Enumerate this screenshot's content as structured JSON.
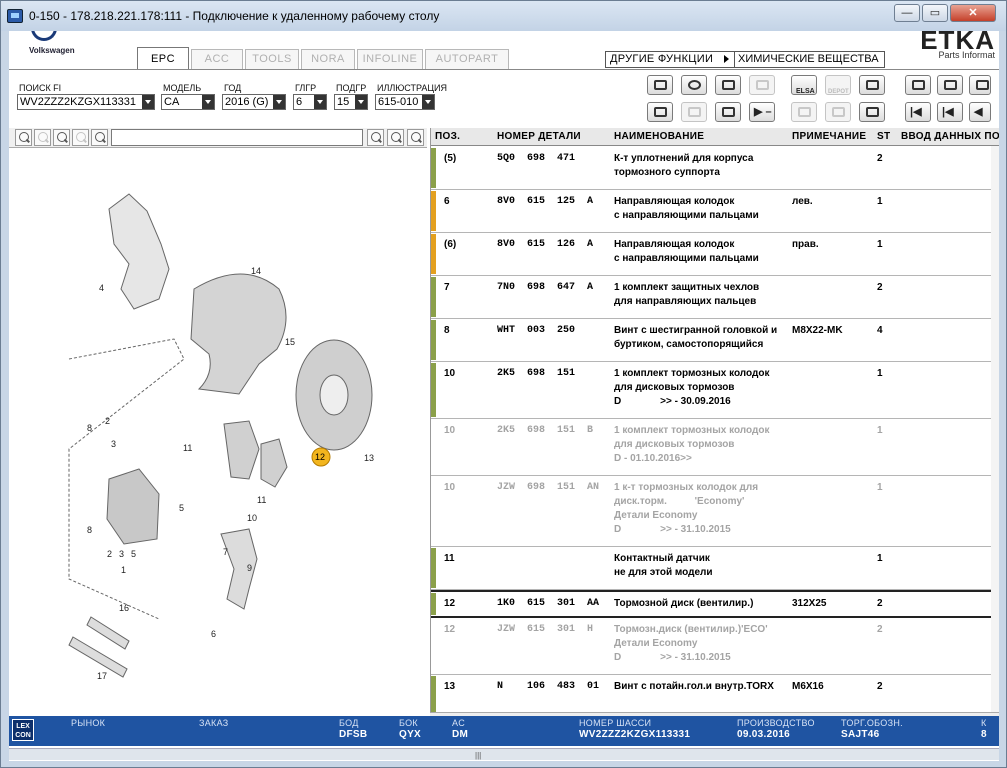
{
  "window": {
    "title": "0-150 - 178.218.221.178:111 - Подключение к удаленному рабочему столу",
    "minimize_label": "—",
    "maximize_label": "▭",
    "close_label": "✕"
  },
  "header": {
    "brand": "Volkswagen",
    "app_logo": "ETKA",
    "app_logo_sub": "Parts Informat",
    "tabs": [
      {
        "label": "EPC",
        "active": true
      },
      {
        "label": "ACC",
        "active": false
      },
      {
        "label": "TOOLS",
        "active": false
      },
      {
        "label": "NORA",
        "active": false
      },
      {
        "label": "INFOLINE",
        "active": false
      },
      {
        "label": "AUTOPART",
        "active": false
      }
    ],
    "other_functions_label": "ДРУГИЕ ФУНКЦИИ",
    "other_functions_value": "ХИМИЧЕСКИЕ ВЕЩЕСТВА"
  },
  "filters": {
    "search_fi": {
      "label": "ПОИСК FI",
      "value": "WV2ZZZ2KZGX113331"
    },
    "model": {
      "label": "МОДЕЛЬ",
      "value": "CA"
    },
    "year": {
      "label": "ГОД",
      "value": "2016 (G)"
    },
    "main_group": {
      "label": "ГЛГР",
      "value": "6"
    },
    "sub_group": {
      "label": "ПОДГР",
      "value": "15"
    },
    "illustration": {
      "label": "ИЛЛЮСТРАЦИЯ",
      "value": "615-010"
    }
  },
  "toolbar": {
    "elsa_label": "ELSA",
    "depot_label": "DEPOT"
  },
  "illustration": {
    "callouts": [
      "4",
      "14",
      "15",
      "12",
      "13",
      "11",
      "8",
      "10",
      "11",
      "2",
      "3",
      "5",
      "2",
      "3",
      "5",
      "1",
      "8",
      "7",
      "9",
      "6",
      "16",
      "17"
    ]
  },
  "table": {
    "columns": [
      "ПОЗ.",
      "НОМЕР ДЕТАЛИ",
      "НАИМЕНОВАНИЕ",
      "ПРИМЕЧАНИЕ",
      "ST",
      "ВВОД ДАННЫХ ПО"
    ],
    "rows": [
      {
        "pos": "(5)",
        "part": "5Q0  698  471",
        "name": "К-т уплотнений для корпуса\nтормозного суппорта",
        "note": "",
        "st": "2",
        "bar": "#8ba04a",
        "grey": false
      },
      {
        "pos": "6",
        "part": "8V0  615  125  A",
        "name": "Направляющая колодок\nс направляющими пальцами",
        "note": "лев.",
        "st": "1",
        "bar": "#e3a020",
        "grey": false
      },
      {
        "pos": "(6)",
        "part": "8V0  615  126  A",
        "name": "Направляющая колодок\nс направляющими пальцами",
        "note": "прав.",
        "st": "1",
        "bar": "#e3a020",
        "grey": false
      },
      {
        "pos": "7",
        "part": "7N0  698  647  A",
        "name": "1 комплект защитных чехлов\nдля направляющих пальцев",
        "note": "",
        "st": "2",
        "bar": "#8ba04a",
        "grey": false
      },
      {
        "pos": "8",
        "part": "WHT  003  250",
        "name": "Винт с шестигранной головкой и\nбуртиком, самостопорящийся",
        "note": "M8X22-MK",
        "st": "4",
        "bar": "#8ba04a",
        "grey": false
      },
      {
        "pos": "10",
        "part": "2K5  698  151",
        "name": "1 комплект тормозных колодок\nдля дисковых тормозов\nD              >> - 30.09.2016",
        "note": "",
        "st": "1",
        "bar": "#8ba04a",
        "grey": false
      },
      {
        "pos": "10",
        "part": "2K5  698  151  B",
        "name": "1 комплект тормозных колодок\nдля дисковых тормозов\nD - 01.10.2016>>",
        "note": "",
        "st": "1",
        "bar": "",
        "grey": true
      },
      {
        "pos": "10",
        "part": "JZW  698  151  AN",
        "name": "1 к-т тормозных колодок для\nдиск.торм.          'Economy'\nДетали Economy\nD              >> - 31.10.2015",
        "note": "",
        "st": "1",
        "bar": "",
        "grey": true
      },
      {
        "pos": "11",
        "part": "",
        "name": "Контактный датчик\nне для этой модели",
        "note": "",
        "st": "1",
        "bar": "#8ba04a",
        "grey": false
      },
      {
        "pos": "12",
        "part": "1K0  615  301  AA",
        "name": "Тормозной диск (вентилир.)",
        "note": "312X25",
        "st": "2",
        "bar": "#8ba04a",
        "grey": false,
        "selected": true
      },
      {
        "pos": "12",
        "part": "JZW  615  301  H",
        "name": "Тормозн.диск (вентилир.)'ECO'\nДетали Economy\nD              >> - 31.10.2015",
        "note": "",
        "st": "2",
        "bar": "",
        "grey": true
      },
      {
        "pos": "13",
        "part": "N    106  483  01",
        "name": "Винт с потайн.гол.и внутр.TORX",
        "note": "M6X16",
        "st": "2",
        "bar": "#8ba04a",
        "grey": false
      }
    ]
  },
  "status": {
    "lex_label": "LEX\nCON",
    "market_label": "РЫНОК",
    "order_label": "ЗАКАЗ",
    "bod_label": "БОД",
    "bod_value": "DFSB",
    "bok_label": "БОК",
    "bok_value": "QYX",
    "ac_label": "AC",
    "ac_value": "DM",
    "chassis_label": "НОМЕР ШАССИ",
    "chassis_value": "WV2ZZZ2KZGX113331",
    "production_label": "ПРОИЗВОДСТВО",
    "production_value": "09.03.2016",
    "trade_label": "ТОРГ.ОБОЗН.",
    "trade_value": "SAJT46",
    "extra_label": "К",
    "extra_value": "8"
  },
  "bottom_scroll_grip": "|||"
}
